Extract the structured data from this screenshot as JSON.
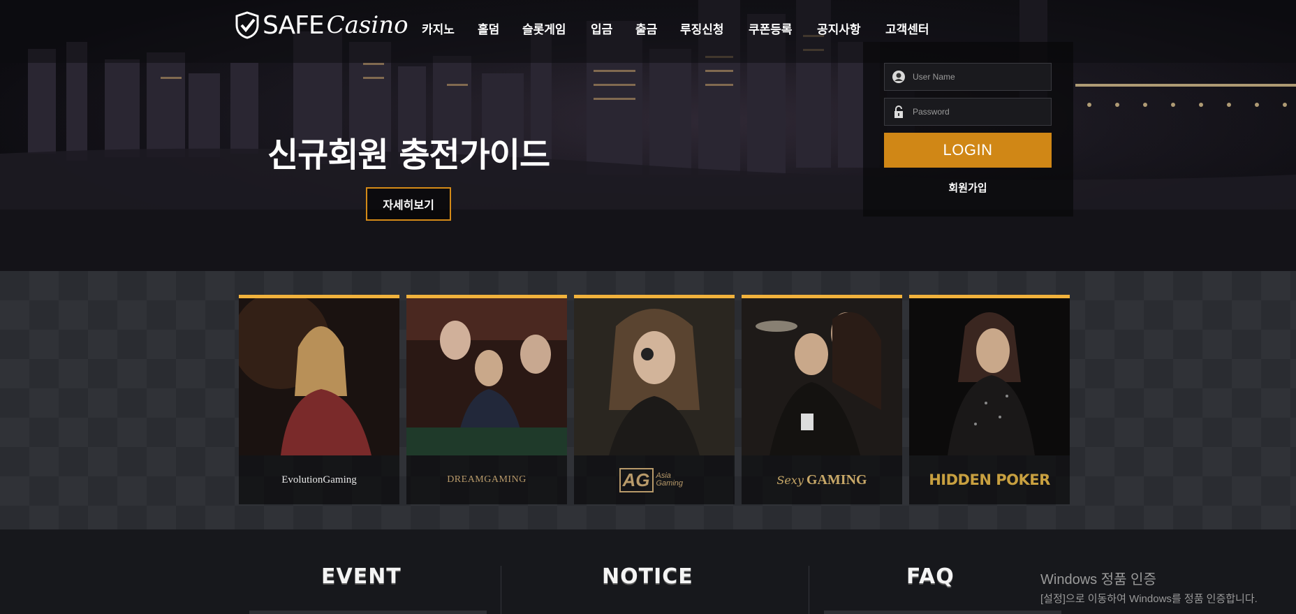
{
  "brand": {
    "safe": "SAFE",
    "casino": "Casino"
  },
  "nav": {
    "items": [
      "카지노",
      "홀덤",
      "슬롯게임",
      "입금",
      "출금",
      "루징신청",
      "쿠폰등록",
      "공지사항",
      "고객센터"
    ]
  },
  "hero": {
    "headline": "신규회원 충전가이드",
    "more_button": "자세히보기"
  },
  "login": {
    "username_placeholder": "User Name",
    "password_placeholder": "Password",
    "login_button": "LOGIN",
    "signup_link": "회원가입"
  },
  "games": [
    {
      "name": "EvolutionGaming"
    },
    {
      "name": "DREAMGAMING"
    },
    {
      "name": "AG",
      "sub": "Asia Gaming"
    },
    {
      "name": "Sexy",
      "sub": "GAMING"
    },
    {
      "name": "HIDDEN POKER"
    }
  ],
  "sections": {
    "event": "EVENT",
    "notice": "NOTICE",
    "faq": "FAQ"
  },
  "watermark": {
    "line1": "Windows 정품 인증",
    "line2": "[설정]으로 이동하여 Windows를 정품 인증합니다."
  },
  "colors": {
    "accent": "#d08716",
    "card_border": "#f1b23c",
    "bg_dark": "#17181c"
  }
}
